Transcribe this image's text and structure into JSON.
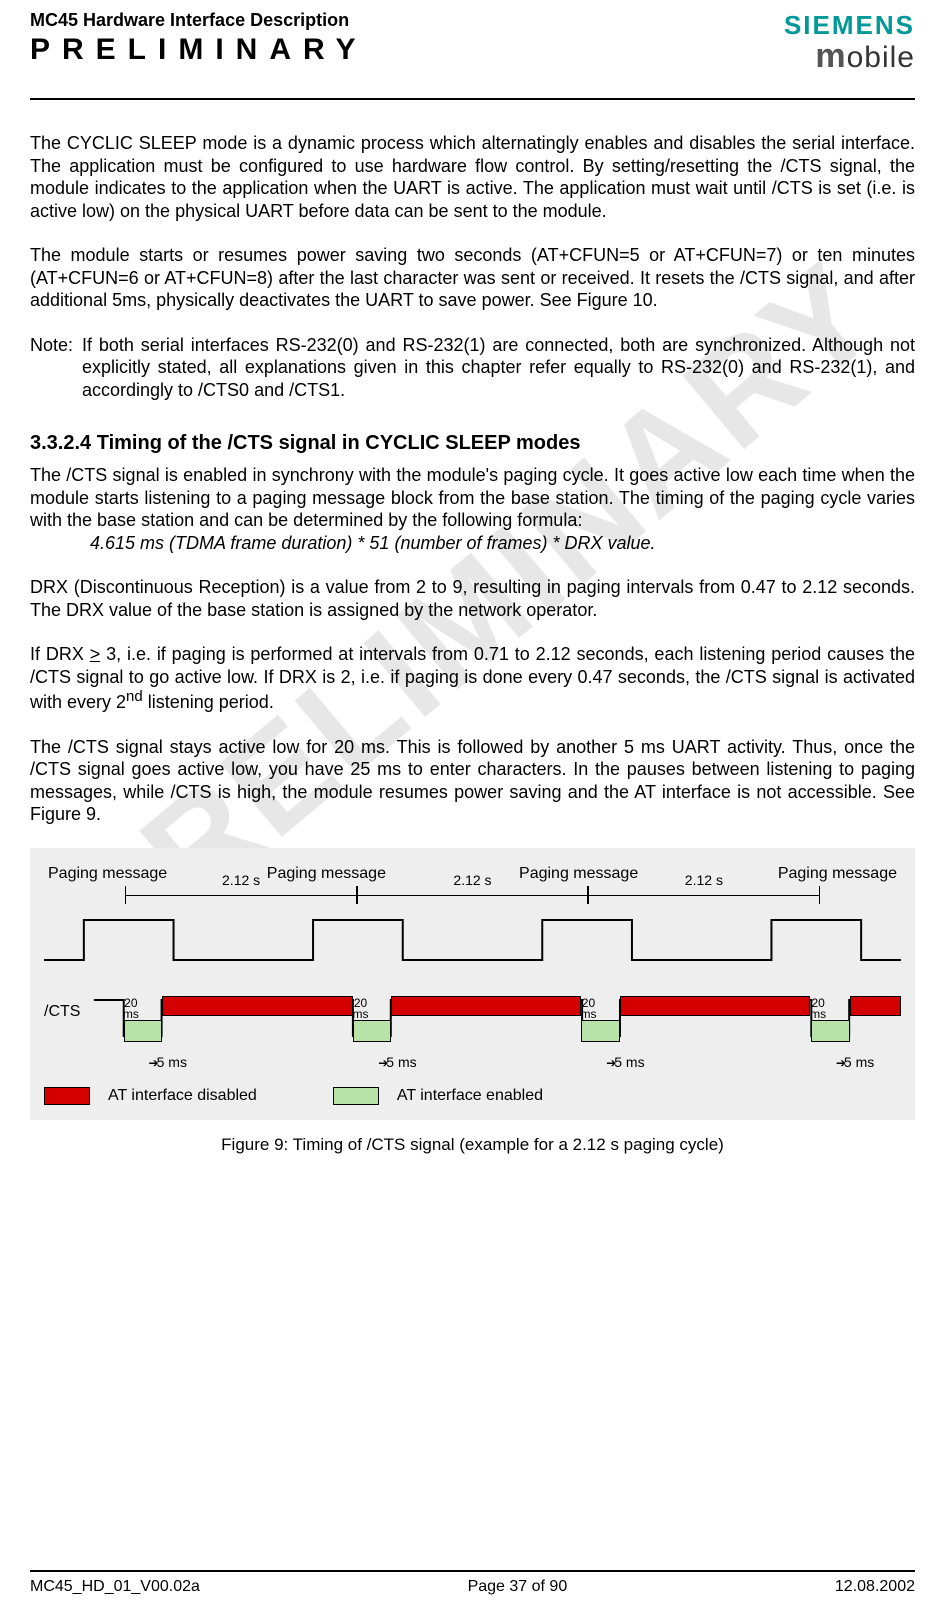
{
  "watermark": "PRELIMINARY",
  "header": {
    "doc_title": "MC45 Hardware Interface Description",
    "preliminary": "PRELIMINARY",
    "brand_top": "SIEMENS",
    "brand_bottom_m": "m",
    "brand_bottom_rest": "obile"
  },
  "body": {
    "p1": "The CYCLIC SLEEP mode is a dynamic process which alternatingly enables and disables the serial interface. The application must be configured to use hardware flow control. By setting/resetting the /CTS signal, the module indicates to the application when the UART is active. The application must wait until /CTS is set (i.e. is active low) on the physical UART before data can be sent to the module.",
    "p2": "The module starts or resumes power saving two seconds (AT+CFUN=5 or AT+CFUN=7) or ten minutes (AT+CFUN=6 or AT+CFUN=8) after the last character was sent or received. It resets the /CTS signal, and after additional 5ms, physically deactivates the UART to save power. See Figure 10.",
    "note_label": "Note:",
    "note_text": "If both serial interfaces RS-232(0) and RS-232(1) are connected, both are synchronized. Although not explicitly stated, all explanations given in this chapter refer equally to RS-232(0) and RS-232(1), and accordingly to /CTS0 and /CTS1.",
    "h3": "3.3.2.4  Timing of the /CTS signal in CYCLIC SLEEP modes",
    "p3": "The /CTS signal is enabled in synchrony with the module's paging cycle. It goes active low each time when the module starts listening to a paging message block from the base station. The timing of the paging cycle varies with the base station and can be determined by the following formula:",
    "formula": "4.615 ms (TDMA frame duration) * 51 (number of frames) * DRX value.",
    "p4": "DRX (Discontinuous Reception) is a value from 2 to 9, resulting in paging intervals from 0.47 to 2.12 seconds. The DRX value of the base station is assigned by the network operator.",
    "p5a": "If DRX ",
    "p5_ge": ">",
    "p5b": " 3, i.e. if paging is performed at intervals from 0.71 to 2.12 seconds, each listening period causes the /CTS signal to go active low. If DRX is 2, i.e. if paging is done every 0.47 seconds, the /CTS signal is activated with every 2",
    "p5_sup": "nd",
    "p5c": " listening period.",
    "p6": "The /CTS signal stays active low for 20 ms. This is followed by another 5 ms UART activity. Thus, once the /CTS signal goes active low, you have 25 ms to enter characters. In the pauses between listening to paging messages, while /CTS is high, the module resumes power saving and the AT interface is not accessible. See Figure 9."
  },
  "figure": {
    "paging_label": "Paging message",
    "interval": "2.12 s",
    "cts": "/CTS",
    "t20a": "20",
    "t20b": "ms",
    "t5": "5 ms",
    "legend_disabled": "AT interface disabled",
    "legend_enabled": "AT interface enabled",
    "caption": "Figure 9: Timing of /CTS signal (example for a 2.12 s paging cycle)"
  },
  "footer": {
    "left": "MC45_HD_01_V00.02a",
    "center": "Page 37 of 90",
    "right": "12.08.2002"
  },
  "chart_data": {
    "type": "timing-diagram",
    "top_trace": {
      "name": "Paging message",
      "pulses": 4,
      "period_s": 2.12,
      "period_label": "2.12 s"
    },
    "bottom_trace": {
      "name": "/CTS",
      "events_per_period": {
        "active_low_ms": 20,
        "extra_uart_activity_ms": 5,
        "total_window_ms": 25
      },
      "repeats": 4
    },
    "legend": [
      {
        "color": "#d40000",
        "label": "AT interface disabled"
      },
      {
        "color": "#b7e2a8",
        "label": "AT interface enabled"
      }
    ],
    "caption": "Figure 9: Timing of /CTS signal (example for a 2.12 s paging cycle)"
  }
}
